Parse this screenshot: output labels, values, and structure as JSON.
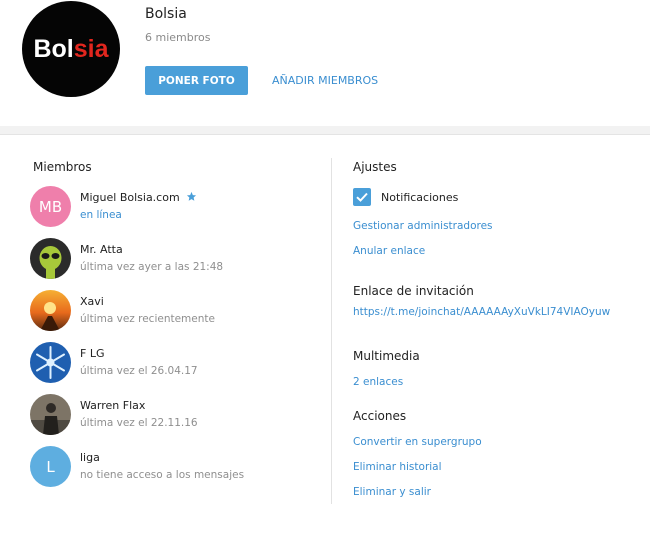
{
  "group": {
    "title": "Bolsia",
    "members_count": "6 miembros",
    "logo_white": "Bol",
    "logo_red": "sia"
  },
  "actions": {
    "set_photo": "PONER FOTO",
    "add_members": "AÑADIR MIEMBROS"
  },
  "members": {
    "title": "Miembros",
    "list": [
      {
        "name": "Miguel Bolsia.com",
        "status": "en línea",
        "initials": "MB",
        "color": "#ef7fab",
        "star_icon": "star-icon"
      },
      {
        "name": "Mr. Atta",
        "status": "última vez ayer a las 21:48"
      },
      {
        "name": "Xavi",
        "status": "última vez recientemente"
      },
      {
        "name": "F LG",
        "status": "última vez el 26.04.17"
      },
      {
        "name": "Warren Flax",
        "status": "última vez el 22.11.16"
      },
      {
        "name": "liga",
        "status": "no tiene acceso a los mensajes",
        "initials": "L",
        "color": "#5eaee0"
      }
    ]
  },
  "settings": {
    "title": "Ajustes",
    "notifications": "Notificaciones",
    "notifications_checked": true,
    "manage_admins": "Gestionar administradores",
    "revoke_link": "Anular enlace"
  },
  "invite": {
    "title": "Enlace de invitación",
    "url": "https://t.me/joinchat/AAAAAAyXuVkLI74VIAOyuw"
  },
  "media": {
    "title": "Multimedia",
    "links": "2 enlaces"
  },
  "acciones": {
    "title": "Acciones",
    "convert": "Convertir en supergrupo",
    "delete_history": "Eliminar historial",
    "delete_leave": "Eliminar y salir"
  },
  "colors": {
    "accent": "#4a9fd9",
    "link": "#3a8ed0",
    "muted": "#8f8f8f"
  }
}
